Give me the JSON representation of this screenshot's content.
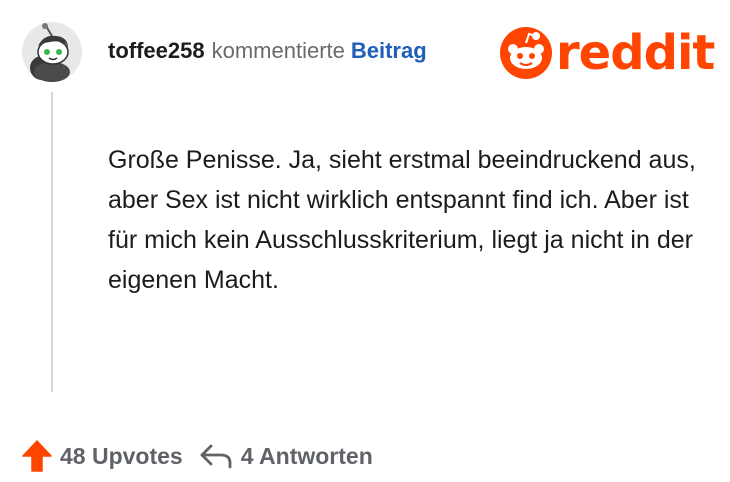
{
  "comment": {
    "username": "toffee258",
    "action": "kommentierte",
    "post_link": "Beitrag",
    "body": "Große Penisse. Ja, sieht erstmal beeindruckend aus, aber Sex ist nicht wirklich entspannt find ich. Aber ist für mich kein Ausschlusskriterium, liegt ja nicht in der eigenen Macht."
  },
  "brand": {
    "name": "reddit",
    "color": "#ff4500"
  },
  "footer": {
    "upvotes": "48 Upvotes",
    "replies": "4 Antworten"
  },
  "icons": {
    "avatar": "snoo-avatar-icon",
    "logo": "reddit-snoo-logo-icon",
    "upvote": "upvote-arrow-icon",
    "reply": "reply-arrow-icon"
  },
  "colors": {
    "upvote": "#ff4500",
    "link": "#1f5fb8",
    "muted": "#6a6a6a",
    "thread_line": "#d6d6d6"
  }
}
